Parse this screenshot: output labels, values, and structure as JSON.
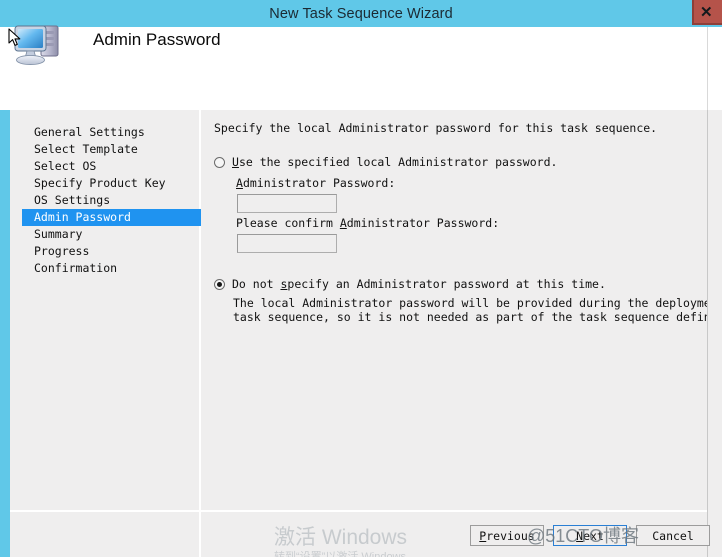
{
  "window": {
    "title": "New Task Sequence Wizard",
    "close_label": "✕",
    "titlebar_color": "#60c8e8",
    "close_color": "#b5534a"
  },
  "header": {
    "title": "Admin Password",
    "icon": "computer-icon"
  },
  "sidebar": {
    "active_color": "#1f93f0",
    "items": [
      {
        "label": "General Settings",
        "active": false
      },
      {
        "label": "Select Template",
        "active": false
      },
      {
        "label": "Select OS",
        "active": false
      },
      {
        "label": "Specify Product Key",
        "active": false
      },
      {
        "label": "OS Settings",
        "active": false
      },
      {
        "label": "Admin Password",
        "active": true
      },
      {
        "label": "Summary",
        "active": false
      },
      {
        "label": "Progress",
        "active": false
      },
      {
        "label": "Confirmation",
        "active": false
      }
    ]
  },
  "content": {
    "intro": "Specify the local Administrator password for this task sequence.",
    "option_specify": {
      "label_pre": "",
      "label_accel": "U",
      "label_post": "se the specified local Administrator password.",
      "selected": false
    },
    "password_label_accel": "A",
    "password_label_pre": "",
    "password_label_post": "dministrator Password:",
    "password_value": "",
    "password_placeholder": "",
    "confirm_label_pre": "Please confirm ",
    "confirm_label_accel": "A",
    "confirm_label_post": "dministrator Password:",
    "confirm_value": "",
    "confirm_placeholder": "",
    "option_nospecify": {
      "label_pre": "Do not ",
      "label_accel": "s",
      "label_post": "pecify an Administrator password at this time.",
      "selected": true
    },
    "description_line1": "The local Administrator password will be provided during the deployment of this",
    "description_line2": "task sequence, so it is not needed as part of the task sequence definition."
  },
  "buttons": {
    "previous_pre": "",
    "previous_accel": "P",
    "previous_post": "revious",
    "next_pre": "",
    "next_accel": "N",
    "next_post": "ext",
    "cancel": "Cancel",
    "focused": "next"
  },
  "watermarks": {
    "activate": "激活 Windows",
    "activate_sub": "转到“设置”以激活 Windows。",
    "site": "@51CTO博客"
  }
}
